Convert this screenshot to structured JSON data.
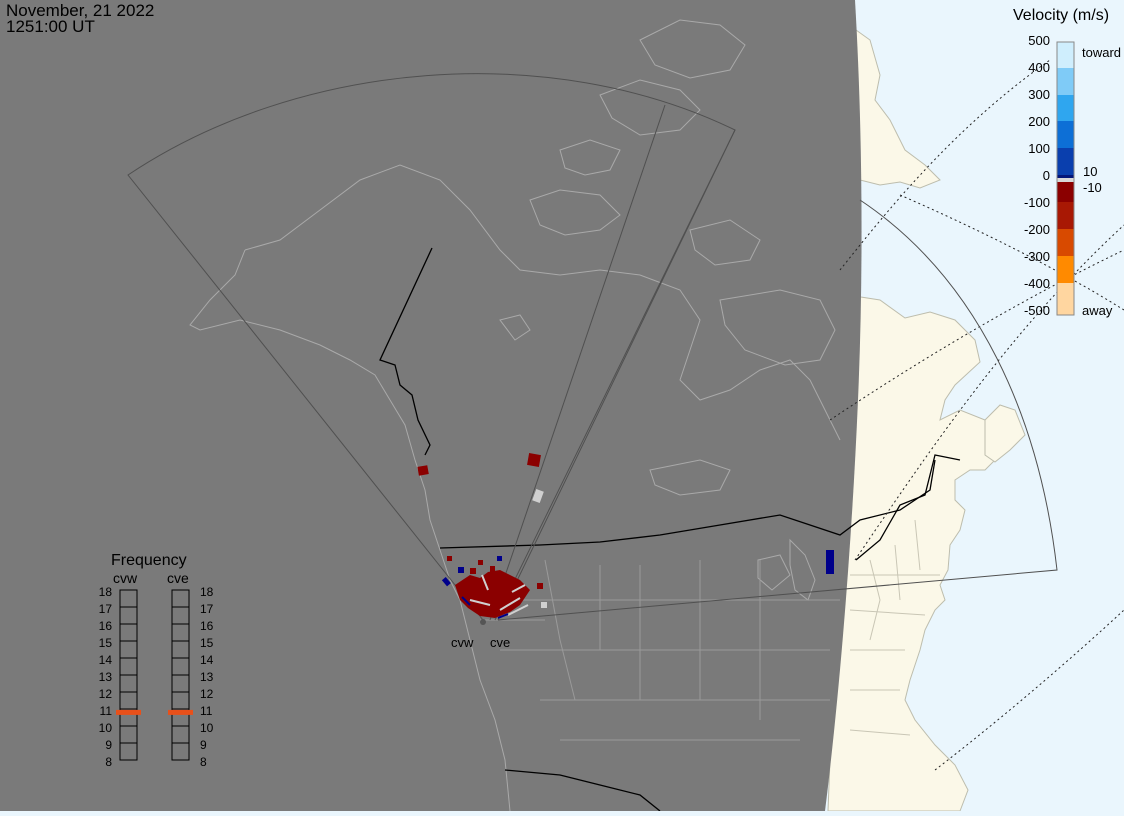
{
  "header": {
    "date": "November, 21 2022",
    "time": "1251:00 UT"
  },
  "colors": {
    "night": "#7a7a7a",
    "ocean_day": "#eaf6fd",
    "land_day": "#fbf8e8",
    "coast_night": "#a9a9a9",
    "coast_day": "#b8b8a8",
    "fov": "#505050",
    "border": "#000000",
    "away_dark": "#8b0000",
    "toward_dark": "#00008b",
    "low_velocity": "#d0d0d0",
    "selected_frequency": "#e8501a"
  },
  "velocity_scale": {
    "title": "Velocity (m/s)",
    "toward_label": "toward",
    "away_label": "away",
    "ticks": [
      "500",
      "400",
      "300",
      "200",
      "100",
      "0",
      "-100",
      "-200",
      "-300",
      "-400",
      "-500"
    ],
    "zero_band_labels": [
      "10",
      "-10"
    ],
    "bands": [
      "#cfeefd",
      "#7fcbf7",
      "#2fa6ef",
      "#0d6fd6",
      "#0a3fae",
      "#04167a",
      "#8b0000",
      "#a81804",
      "#d84a00",
      "#ff8a00",
      "#ffd6a0"
    ]
  },
  "frequency": {
    "title": "Frequency",
    "radars": [
      "cvw",
      "cve"
    ],
    "ticks": [
      "18",
      "17",
      "16",
      "15",
      "14",
      "13",
      "12",
      "11",
      "10",
      "9",
      "8"
    ],
    "selected_mhz": 10.8
  },
  "radar_sites": [
    {
      "code": "cvw",
      "label": "cvw"
    },
    {
      "code": "cve",
      "label": "cve"
    }
  ]
}
